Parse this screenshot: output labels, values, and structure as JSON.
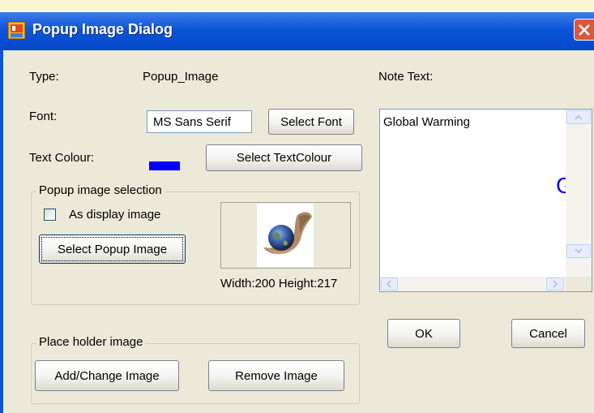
{
  "window": {
    "title": "Popup Image Dialog"
  },
  "type": {
    "label": "Type:",
    "value": "Popup_Image"
  },
  "font": {
    "label": "Font:",
    "value": "MS Sans Serif",
    "button": "Select Font"
  },
  "text_colour": {
    "label": "Text Colour:",
    "color": "#0000ff",
    "button": "Select TextColour"
  },
  "popup_group": {
    "title": "Popup image selection",
    "checkbox_label": "As display image",
    "checked": false,
    "select_button": "Select Popup Image",
    "dimensions": "Width:200 Height:217"
  },
  "note": {
    "label": "Note Text:",
    "text": "Global Warming",
    "preview_text": "Glo",
    "preview_color": "#0000ff"
  },
  "buttons": {
    "ok": "OK",
    "cancel": "Cancel"
  },
  "placeholder_group": {
    "title": "Place holder image",
    "add_button": "Add/Change Image",
    "remove_button": "Remove Image"
  }
}
